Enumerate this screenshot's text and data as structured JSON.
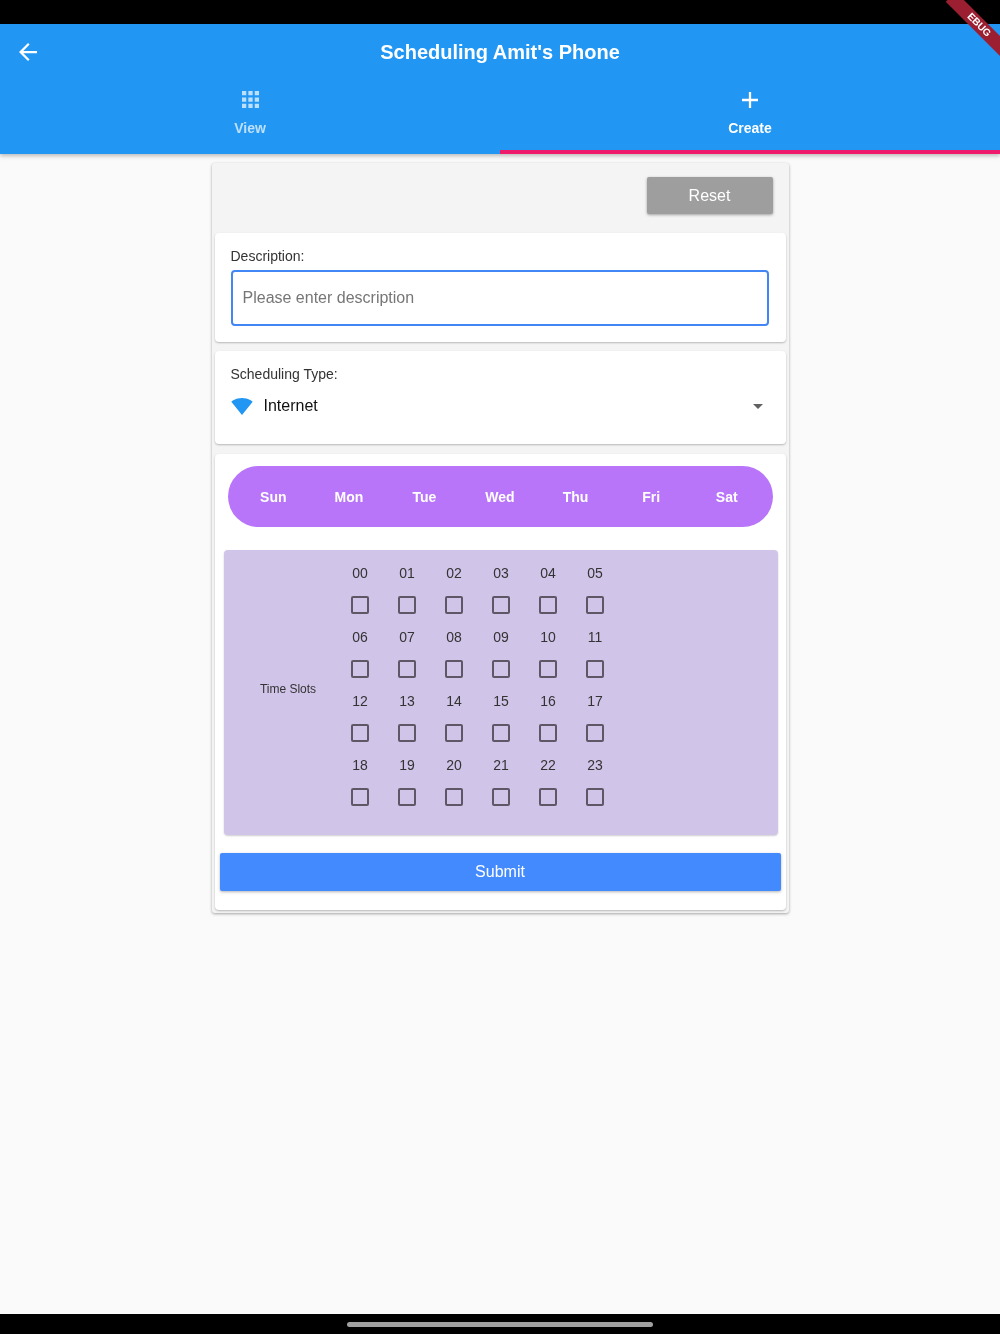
{
  "debug_banner": {
    "label": "EBUG"
  },
  "app_bar": {
    "title": "Scheduling Amit's Phone"
  },
  "tabs": [
    {
      "label": "View",
      "selected": false
    },
    {
      "label": "Create",
      "selected": true
    }
  ],
  "reset_button": {
    "label": "Reset"
  },
  "description": {
    "label": "Description:",
    "placeholder": "Please enter description"
  },
  "scheduling_type": {
    "label": "Scheduling Type:",
    "value": "Internet"
  },
  "days": [
    {
      "label": "Sun",
      "selected": false
    },
    {
      "label": "Mon",
      "selected": false
    },
    {
      "label": "Tue",
      "selected": false
    },
    {
      "label": "Wed",
      "selected": false
    },
    {
      "label": "Thu",
      "selected": false
    },
    {
      "label": "Fri",
      "selected": false
    },
    {
      "label": "Sat",
      "selected": false
    }
  ],
  "time_slots": {
    "label": "Time Slots",
    "slots": [
      {
        "label": "00",
        "checked": false
      },
      {
        "label": "01",
        "checked": false
      },
      {
        "label": "02",
        "checked": false
      },
      {
        "label": "03",
        "checked": false
      },
      {
        "label": "04",
        "checked": false
      },
      {
        "label": "05",
        "checked": false
      },
      {
        "label": "06",
        "checked": false
      },
      {
        "label": "07",
        "checked": false
      },
      {
        "label": "08",
        "checked": false
      },
      {
        "label": "09",
        "checked": false
      },
      {
        "label": "10",
        "checked": false
      },
      {
        "label": "11",
        "checked": false
      },
      {
        "label": "12",
        "checked": false
      },
      {
        "label": "13",
        "checked": false
      },
      {
        "label": "14",
        "checked": false
      },
      {
        "label": "15",
        "checked": false
      },
      {
        "label": "16",
        "checked": false
      },
      {
        "label": "17",
        "checked": false
      },
      {
        "label": "18",
        "checked": false
      },
      {
        "label": "19",
        "checked": false
      },
      {
        "label": "20",
        "checked": false
      },
      {
        "label": "21",
        "checked": false
      },
      {
        "label": "22",
        "checked": false
      },
      {
        "label": "23",
        "checked": false
      }
    ]
  },
  "submit_button": {
    "label": "Submit"
  }
}
